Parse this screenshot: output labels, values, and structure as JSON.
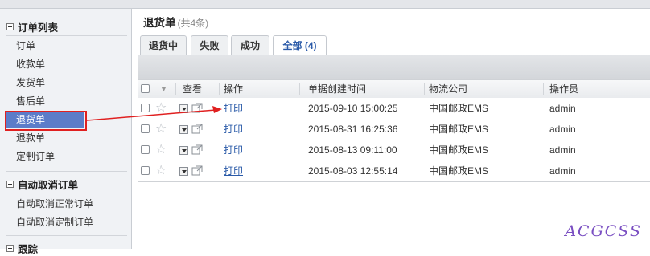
{
  "sidebar": {
    "sections": [
      {
        "title": "订单列表",
        "items": [
          "订单",
          "收款单",
          "发货单",
          "售后单",
          "退货单",
          "退款单",
          "定制订单"
        ]
      },
      {
        "title": "自动取消订单",
        "items": [
          "自动取消正常订单",
          "自动取消定制订单"
        ]
      },
      {
        "title": "跟踪"
      }
    ],
    "active_item": "退货单"
  },
  "page": {
    "title": "退货单",
    "count": "(共4条)"
  },
  "tabs": [
    "退货中",
    "失败",
    "成功",
    "全部 (4)"
  ],
  "active_tab": "全部 (4)",
  "grid": {
    "sort_arrow": "▼",
    "columns": [
      "查看",
      "操作",
      "单据创建时间",
      "物流公司",
      "操作员"
    ],
    "rows": [
      {
        "action": "打印",
        "created": "2015-09-10 15:00:25",
        "logistics": "中国邮政EMS",
        "operator": "admin"
      },
      {
        "action": "打印",
        "created": "2015-08-31 16:25:36",
        "logistics": "中国邮政EMS",
        "operator": "admin"
      },
      {
        "action": "打印",
        "created": "2015-08-13 09:11:00",
        "logistics": "中国邮政EMS",
        "operator": "admin"
      },
      {
        "action": "打印",
        "created": "2015-08-03 12:55:14",
        "logistics": "中国邮政EMS",
        "operator": "admin"
      }
    ]
  },
  "watermark": "ACGCSS",
  "colors": {
    "accent": "#2a5aa8",
    "active_item_bg": "#5c7cc9",
    "highlight": "#e02020"
  },
  "icons": [
    "star-icon",
    "dropdown-icon",
    "popout-icon",
    "collapse-icon",
    "arrow-annotation"
  ]
}
